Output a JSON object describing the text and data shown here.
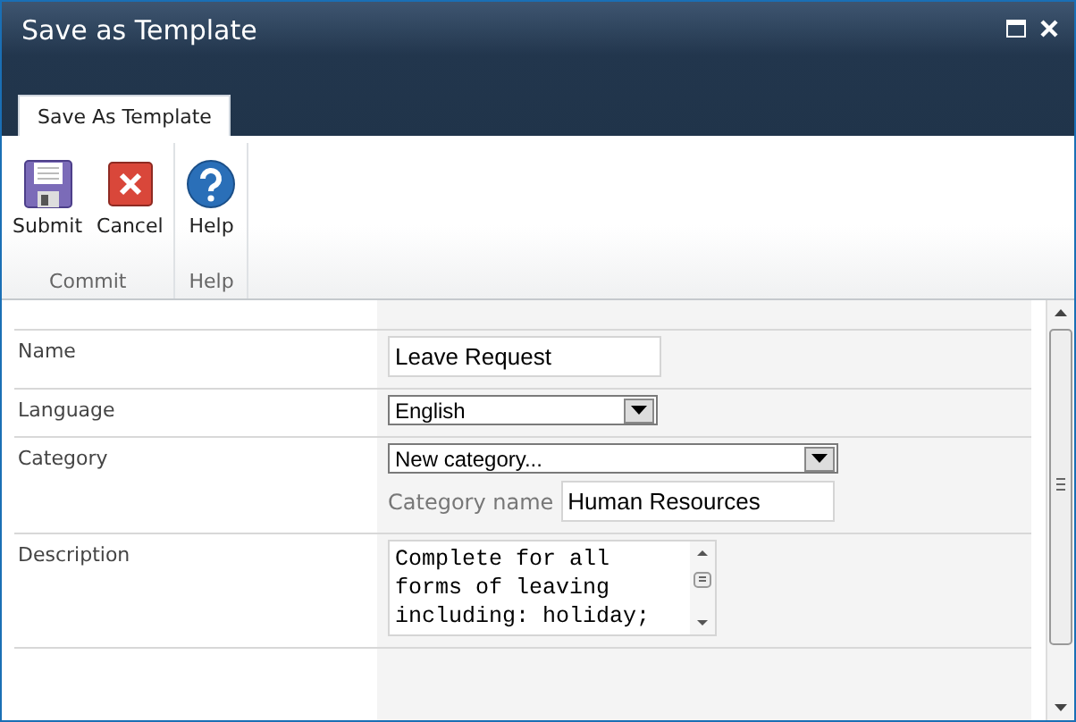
{
  "window": {
    "title": "Save as Template"
  },
  "tabs": [
    {
      "label": "Save As Template",
      "selected": true
    }
  ],
  "ribbon_groups": [
    {
      "label": "Commit",
      "buttons": [
        {
          "label": "Submit",
          "kind": "save"
        },
        {
          "label": "Cancel",
          "kind": "cancel"
        }
      ]
    },
    {
      "label": "Help",
      "buttons": [
        {
          "label": "Help",
          "kind": "help"
        }
      ]
    }
  ],
  "form": [
    {
      "label": "Name",
      "kind": "text",
      "value": "Leave Request"
    },
    {
      "label": "Language",
      "kind": "select",
      "value": "English"
    },
    {
      "label": "Category",
      "kind": "select-with-name",
      "value": "New category...",
      "sub_label": "Category name",
      "sub_value": "Human Resources"
    },
    {
      "label": "Description",
      "kind": "textarea",
      "value": "Complete for all forms of leaving including: holiday;"
    }
  ]
}
